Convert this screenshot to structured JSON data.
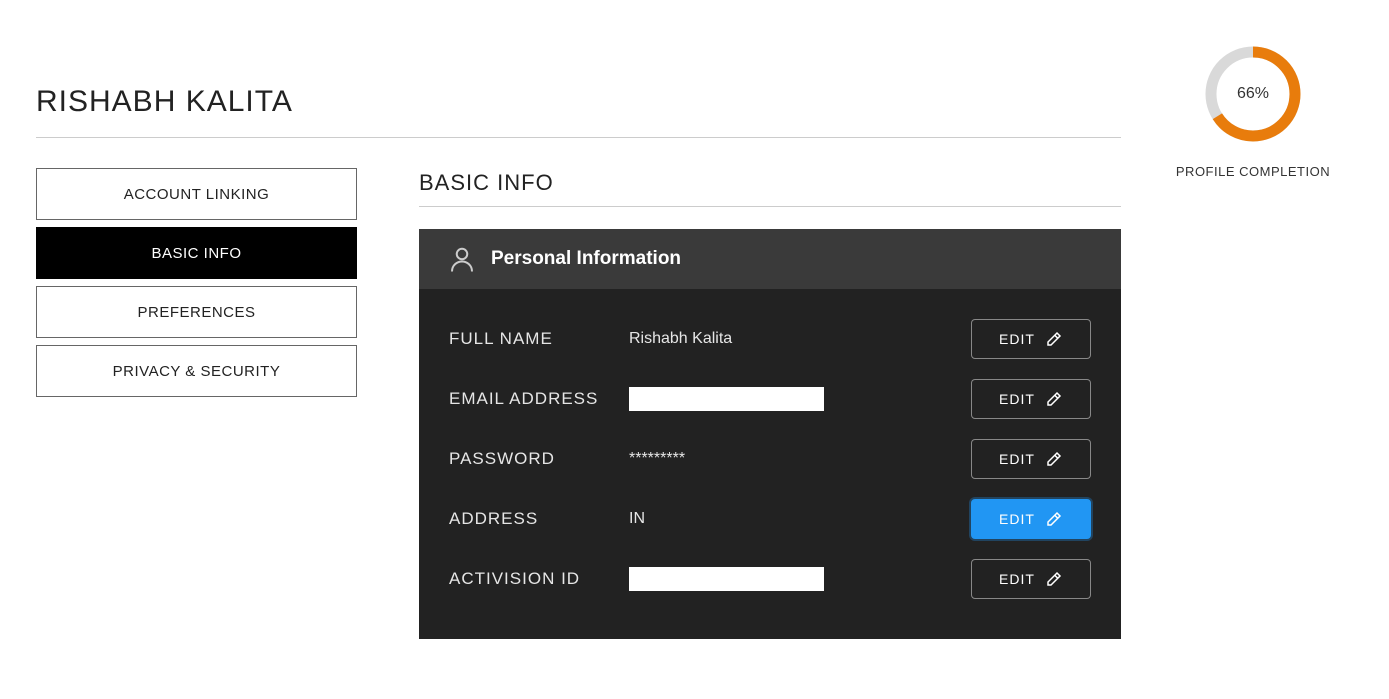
{
  "user_name": "RISHABH KALITA",
  "sidebar": {
    "items": [
      {
        "label": "ACCOUNT LINKING"
      },
      {
        "label": "BASIC INFO"
      },
      {
        "label": "PREFERENCES"
      },
      {
        "label": "PRIVACY & SECURITY"
      }
    ],
    "active_index": 1
  },
  "section_heading": "BASIC INFO",
  "panel_title": "Personal Information",
  "fields": {
    "full_name": {
      "label": "FULL NAME",
      "value": "Rishabh Kalita",
      "masked": false
    },
    "email": {
      "label": "EMAIL ADDRESS",
      "value": "",
      "masked": true
    },
    "password": {
      "label": "PASSWORD",
      "value": "*********",
      "masked": false
    },
    "address": {
      "label": "ADDRESS",
      "value": "IN",
      "masked": false,
      "highlight": true
    },
    "activision": {
      "label": "ACTIVISION ID",
      "value": "",
      "masked": true
    }
  },
  "edit_label": "EDIT",
  "completion": {
    "percent": 66,
    "display": "66%",
    "caption": "PROFILE COMPLETION",
    "color": "#e87c0c",
    "track": "#d9d9d9"
  }
}
